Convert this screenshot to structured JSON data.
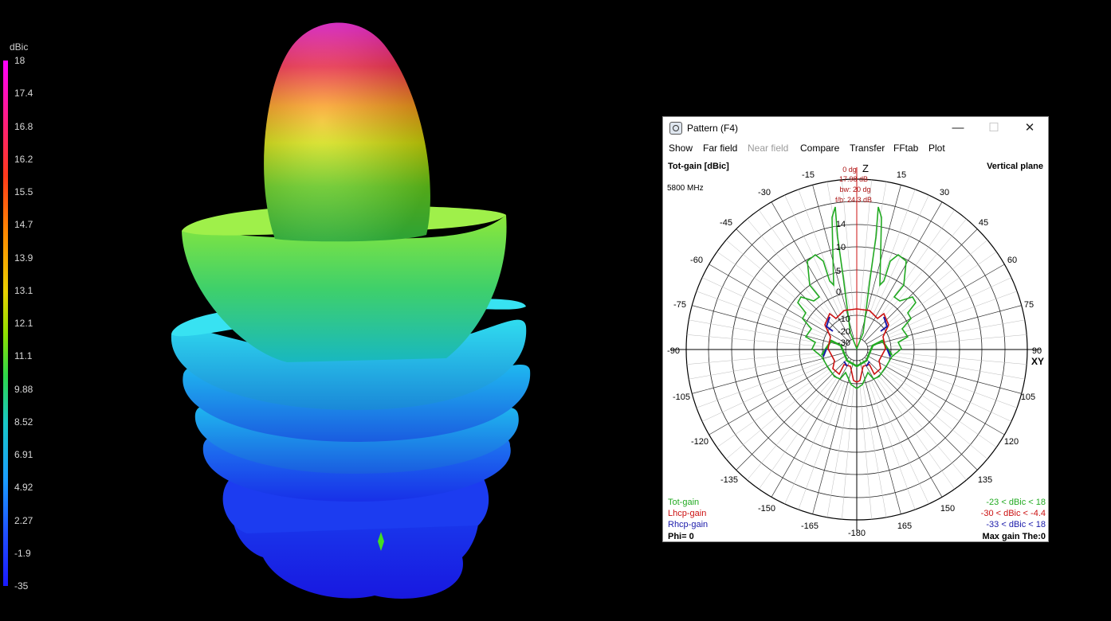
{
  "colorbar": {
    "unit": "dBic",
    "ticks": [
      "18",
      "17.4",
      "16.8",
      "16.2",
      "15.5",
      "14.7",
      "13.9",
      "13.1",
      "12.1",
      "11.1",
      "9.88",
      "8.52",
      "6.91",
      "4.92",
      "2.27",
      "-1.9",
      "-35"
    ]
  },
  "window": {
    "title": "Pattern   (F4)",
    "minimize": "—",
    "maximize": "☐",
    "close": "✕",
    "menu": [
      "Show",
      "Far field",
      "Near field",
      "Compare",
      "Transfer",
      "FFtab",
      "Plot"
    ]
  },
  "plot": {
    "title_left": "Tot-gain [dBic]",
    "title_right": "Vertical plane",
    "frequency": "5800 MHz",
    "z_label": "Z",
    "xy_label": "XY",
    "angle_labels": [
      "-15",
      "15",
      "-30",
      "30",
      "-45",
      "45",
      "-60",
      "60",
      "-75",
      "75",
      "-90",
      "90",
      "-105",
      "105",
      "-120",
      "120",
      "-135",
      "135",
      "-150",
      "150",
      "-165",
      "165",
      "-180"
    ],
    "ring_labels": [
      "14",
      "10",
      "5",
      "0",
      "-10",
      "-20",
      "-30"
    ],
    "info": [
      "0 dg",
      "17.98 dB",
      "bw: 20 dg",
      "f/b: 24.3 dB"
    ],
    "legend": [
      {
        "name": "Tot-gain",
        "range": "-23 < dBic < 18",
        "color": "#22aa22"
      },
      {
        "name": "Lhcp-gain",
        "range": "-30 < dBic < -4.4",
        "color": "#cc1111"
      },
      {
        "name": "Rhcp-gain",
        "range": "-33 < dBic < 18",
        "color": "#1a1aaa"
      }
    ],
    "footer_left": "Phi= 0",
    "footer_right": "Max gain The:0"
  }
}
